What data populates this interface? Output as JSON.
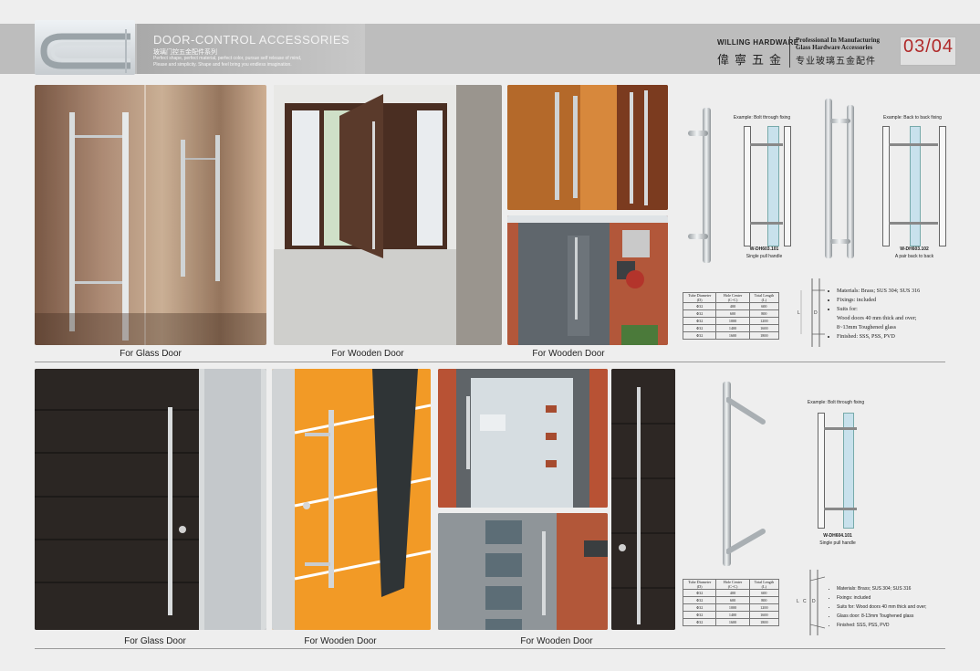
{
  "header": {
    "title": "DOOR-CONTROL ACCESSORIES",
    "subtitle_cn": "玻璃门控五金配件系列",
    "tagline_1": "Perfect shape, perfect material, perfect color, pursue self release of mind,",
    "tagline_2": "Please and simplicity. Shape and feel bring you endless imagination.",
    "brand": "WILLING HARDWARE",
    "brand_cn": "偉寧五金",
    "pro_line1": "Professional In Manufacturing",
    "pro_line2": "Glass Hardware Accessories",
    "pro_cn": "专业玻璃五金配件",
    "page": "03/04"
  },
  "captions": {
    "top_1": "For Glass Door",
    "top_2": "For Wooden Door",
    "top_3": "For Wooden Door",
    "bottom_1": "For Glass Door",
    "bottom_2": "For Wooden Door",
    "bottom_3": "For Wooden Door"
  },
  "product1": {
    "example_1": "Example: Bolt through fixing",
    "example_2": "Example: Back to back fixing",
    "model_1": "W-DH603.101",
    "model_1_desc": "Single pull handle",
    "model_2": "W-DH603.102",
    "model_2_desc": "A pair back to back",
    "table_headers": [
      "Tube Diameter (D)",
      "Hole Center (C~C)",
      "Total Length (L)"
    ],
    "table_rows": [
      [
        "Φ32",
        "400",
        "600"
      ],
      [
        "Φ32",
        "600",
        "800"
      ],
      [
        "Φ32",
        "1000",
        "1200"
      ],
      [
        "Φ32",
        "1400",
        "1600"
      ],
      [
        "Φ32",
        "1600",
        "1800"
      ]
    ],
    "features": [
      "Materials: Brass; SUS 304; SUS 316",
      "Fixings: included",
      "Suits for:",
      "Wood doors 40 mm thick and over;",
      "8~13mm Toughened glass",
      "Finished: SSS, PSS, PVD"
    ]
  },
  "product2": {
    "example_1": "Example: Bolt through fixing",
    "model_1": "W-DH604.101",
    "model_1_desc": "Single pull handle",
    "table_headers": [
      "Tube Diameter (D)",
      "Hole Center (C~C)",
      "Total Length (L)"
    ],
    "table_rows": [
      [
        "Φ32",
        "400",
        "600"
      ],
      [
        "Φ32",
        "600",
        "800"
      ],
      [
        "Φ32",
        "1000",
        "1200"
      ],
      [
        "Φ32",
        "1400",
        "1600"
      ],
      [
        "Φ32",
        "1600",
        "1800"
      ]
    ],
    "features": [
      "Materials: Brass; SUS 304; SUS 316",
      "Fixings: included",
      "Suits for: Wood doors 40 mm thick and over;",
      "Glass door: 8-13mm Toughened glass",
      "Finished: SSS, PSS, PVD"
    ]
  },
  "dim_labels": {
    "d": "D",
    "l": "L",
    "c": "C"
  }
}
